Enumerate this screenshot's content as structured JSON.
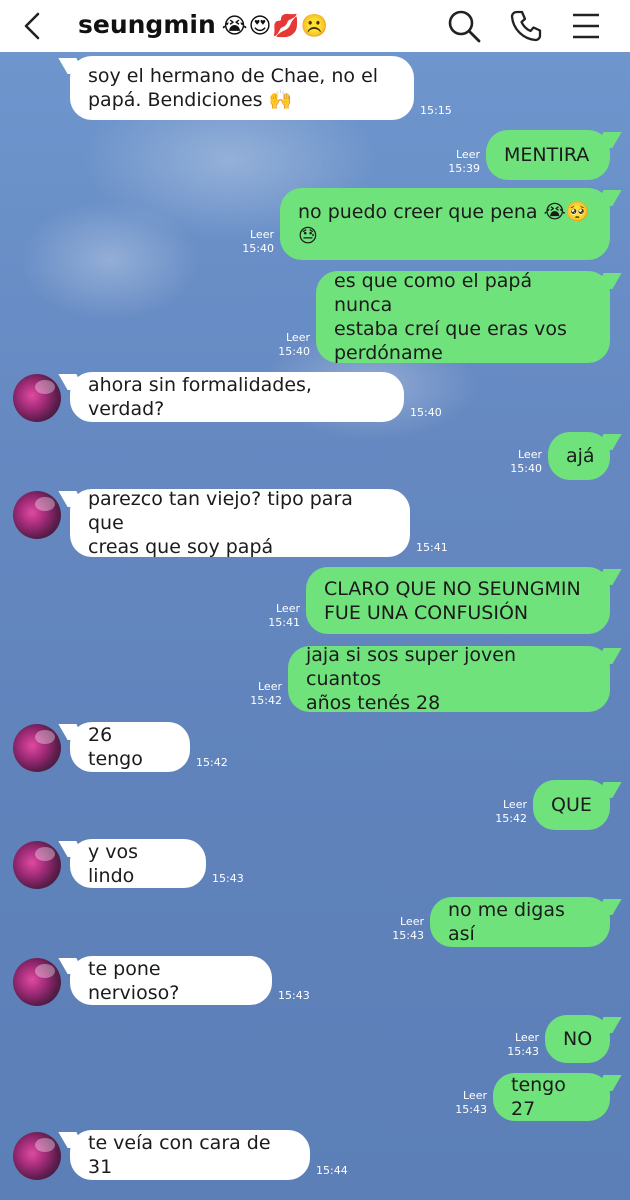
{
  "header": {
    "title": "seungmin",
    "title_emojis": "😭😍💋☹️",
    "back_icon": "chevron-left-icon",
    "search_icon": "search-icon",
    "call_icon": "phone-icon",
    "menu_icon": "hamburger-menu-icon"
  },
  "colors": {
    "outgoing_bubble": "#6fe27c",
    "incoming_bubble": "#ffffff",
    "background": "#6689c2"
  },
  "messages": [
    {
      "sender": "them",
      "text": "soy el hermano de Chae, no el\npapá. Bendiciones 🙌",
      "time": "15:15"
    },
    {
      "sender": "me",
      "text": "MENTIRA",
      "read": "Leer",
      "time": "15:39"
    },
    {
      "sender": "me",
      "text": "no puedo creer que pena 😭🥺\n😓",
      "read": "Leer",
      "time": "15:40"
    },
    {
      "sender": "me",
      "text": "es que como el papá nunca\nestaba creí que eras vos\nperdóname",
      "read": "Leer",
      "time": "15:40"
    },
    {
      "sender": "them",
      "text": "ahora sin formalidades, verdad?",
      "time": "15:40"
    },
    {
      "sender": "me",
      "text": "ajá",
      "read": "Leer",
      "time": "15:40"
    },
    {
      "sender": "them",
      "text": "parezco tan viejo? tipo para que\ncreas que soy papá",
      "time": "15:41"
    },
    {
      "sender": "me",
      "text": "CLARO QUE NO SEUNGMIN\nFUE UNA CONFUSIÓN",
      "read": "Leer",
      "time": "15:41"
    },
    {
      "sender": "me",
      "text": "jaja si sos super joven cuantos\naños tenés 28",
      "read": "Leer",
      "time": "15:42"
    },
    {
      "sender": "them",
      "text": "26 tengo",
      "time": "15:42"
    },
    {
      "sender": "me",
      "text": "QUE",
      "read": "Leer",
      "time": "15:42"
    },
    {
      "sender": "them",
      "text": "y vos lindo",
      "time": "15:43"
    },
    {
      "sender": "me",
      "text": "no me digas así",
      "read": "Leer",
      "time": "15:43"
    },
    {
      "sender": "them",
      "text": "te pone nervioso?",
      "time": "15:43"
    },
    {
      "sender": "me",
      "text": "NO",
      "read": "Leer",
      "time": "15:43"
    },
    {
      "sender": "me",
      "text": "tengo 27",
      "read": "Leer",
      "time": "15:43"
    },
    {
      "sender": "them",
      "text": "te veía con cara de 31",
      "time": "15:44"
    }
  ]
}
